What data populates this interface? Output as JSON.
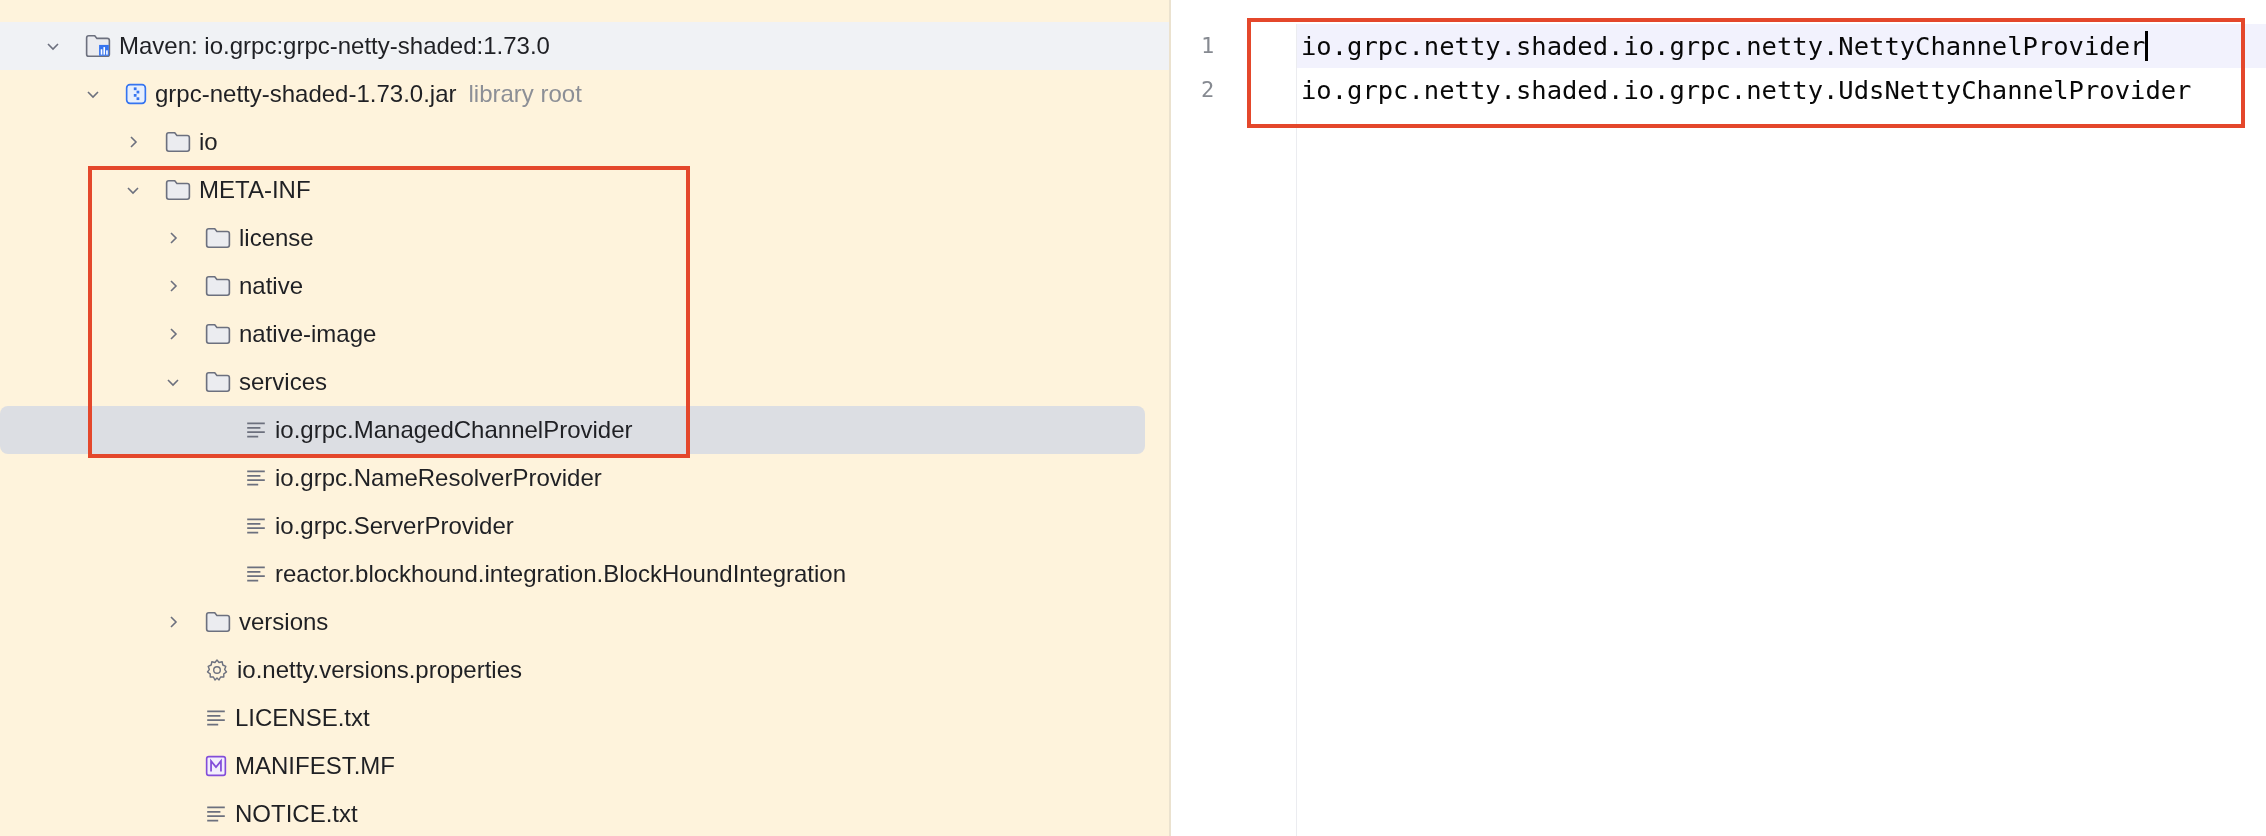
{
  "project_tree": {
    "items": [
      {
        "label": "Maven: io.grpc:grpc-netty-shaded:1.73.0",
        "kind": "library",
        "expanded": true,
        "selected": false,
        "children": [
          {
            "label": "grpc-netty-shaded-1.73.0.jar",
            "suffix": "library root",
            "kind": "jar",
            "expanded": true,
            "selected": false,
            "children": [
              {
                "label": "io",
                "kind": "folder",
                "expanded": false,
                "selected": false
              },
              {
                "label": "META-INF",
                "kind": "folder",
                "expanded": true,
                "selected": false,
                "children": [
                  {
                    "label": "license",
                    "kind": "folder",
                    "expanded": false,
                    "selected": false
                  },
                  {
                    "label": "native",
                    "kind": "folder",
                    "expanded": false,
                    "selected": false
                  },
                  {
                    "label": "native-image",
                    "kind": "folder",
                    "expanded": false,
                    "selected": false
                  },
                  {
                    "label": "services",
                    "kind": "folder",
                    "expanded": true,
                    "selected": false,
                    "children": [
                      {
                        "label": "io.grpc.ManagedChannelProvider",
                        "kind": "text",
                        "selected": true
                      },
                      {
                        "label": "io.grpc.NameResolverProvider",
                        "kind": "text",
                        "selected": false
                      },
                      {
                        "label": "io.grpc.ServerProvider",
                        "kind": "text",
                        "selected": false
                      },
                      {
                        "label": "reactor.blockhound.integration.BlockHoundIntegration",
                        "kind": "text",
                        "selected": false
                      }
                    ]
                  },
                  {
                    "label": "versions",
                    "kind": "folder",
                    "expanded": false,
                    "selected": false
                  },
                  {
                    "label": "io.netty.versions.properties",
                    "kind": "properties",
                    "selected": false
                  },
                  {
                    "label": "LICENSE.txt",
                    "kind": "text",
                    "selected": false
                  },
                  {
                    "label": "MANIFEST.MF",
                    "kind": "manifest",
                    "selected": false
                  },
                  {
                    "label": "NOTICE.txt",
                    "kind": "text",
                    "selected": false
                  }
                ]
              }
            ]
          }
        ]
      }
    ]
  },
  "editor": {
    "lines": [
      {
        "number": "1",
        "text": "io.grpc.netty.shaded.io.grpc.netty.NettyChannelProvider",
        "current": true
      },
      {
        "number": "2",
        "text": "io.grpc.netty.shaded.io.grpc.netty.UdsNettyChannelProvider",
        "current": false
      }
    ]
  }
}
